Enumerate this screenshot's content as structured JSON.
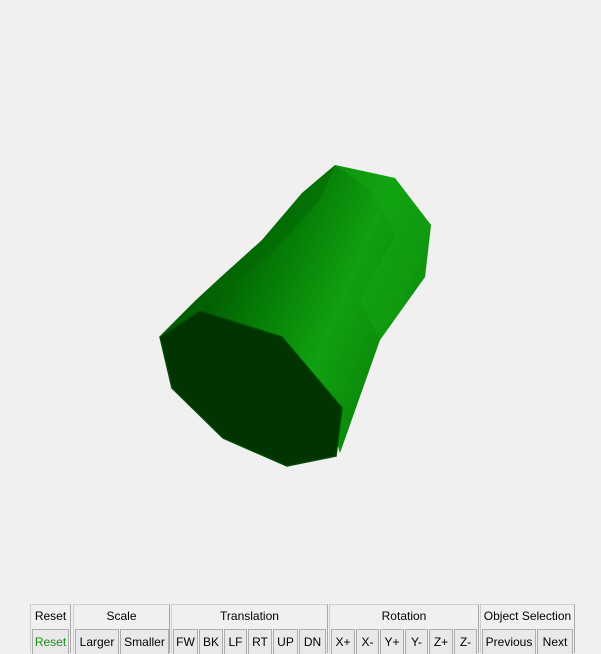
{
  "scene": {
    "object": "cylinder-octagonal",
    "colors": {
      "background": "#f0f0f0",
      "cap": "#013401",
      "side_light": "#10a010",
      "side_dark": "#036303"
    }
  },
  "toolbar": {
    "reset": {
      "title": "Reset",
      "button": "Reset"
    },
    "scale": {
      "title": "Scale",
      "larger": "Larger",
      "smaller": "Smaller"
    },
    "translation": {
      "title": "Translation",
      "fw": "FW",
      "bk": "BK",
      "lf": "LF",
      "rt": "RT",
      "up": "UP",
      "dn": "DN"
    },
    "rotation": {
      "title": "Rotation",
      "xp": "X+",
      "xm": "X-",
      "yp": "Y+",
      "ym": "Y-",
      "zp": "Z+",
      "zm": "Z-"
    },
    "selection": {
      "title": "Object Selection",
      "previous": "Previous",
      "next": "Next"
    }
  }
}
